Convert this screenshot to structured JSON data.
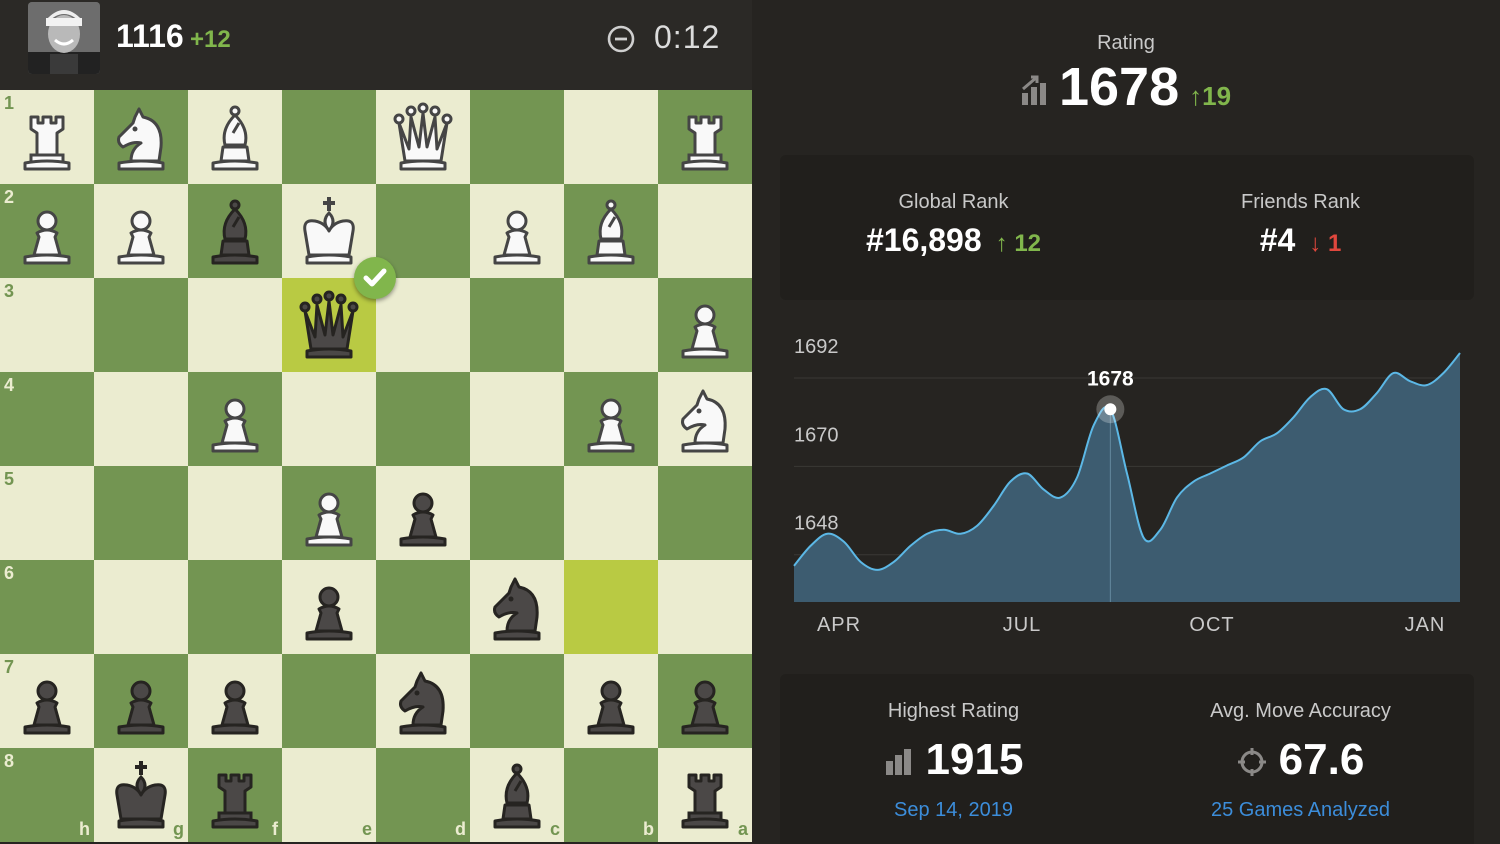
{
  "player": {
    "rating": "1116",
    "rating_delta": "+12",
    "clock": "0:12"
  },
  "board": {
    "rank_labels": [
      "1",
      "2",
      "3",
      "4",
      "5",
      "6",
      "7",
      "8"
    ],
    "file_labels": [
      "h",
      "g",
      "f",
      "e",
      "d",
      "c",
      "b",
      "a"
    ],
    "highlight_squares": [
      "3-3",
      "5-6"
    ],
    "pieces": [
      {
        "r": 0,
        "c": 0,
        "p": "R",
        "w": true
      },
      {
        "r": 0,
        "c": 1,
        "p": "N",
        "w": true
      },
      {
        "r": 0,
        "c": 2,
        "p": "B",
        "w": true
      },
      {
        "r": 0,
        "c": 4,
        "p": "Q",
        "w": true
      },
      {
        "r": 0,
        "c": 7,
        "p": "R",
        "w": true
      },
      {
        "r": 1,
        "c": 0,
        "p": "P",
        "w": true
      },
      {
        "r": 1,
        "c": 1,
        "p": "P",
        "w": true
      },
      {
        "r": 1,
        "c": 2,
        "p": "B",
        "w": false
      },
      {
        "r": 1,
        "c": 3,
        "p": "K",
        "w": true
      },
      {
        "r": 1,
        "c": 5,
        "p": "P",
        "w": true
      },
      {
        "r": 1,
        "c": 6,
        "p": "B",
        "w": true
      },
      {
        "r": 2,
        "c": 3,
        "p": "Q",
        "w": false
      },
      {
        "r": 2,
        "c": 7,
        "p": "P",
        "w": true
      },
      {
        "r": 3,
        "c": 2,
        "p": "P",
        "w": true
      },
      {
        "r": 3,
        "c": 6,
        "p": "P",
        "w": true
      },
      {
        "r": 3,
        "c": 7,
        "p": "N",
        "w": true
      },
      {
        "r": 4,
        "c": 3,
        "p": "P",
        "w": true
      },
      {
        "r": 4,
        "c": 4,
        "p": "P",
        "w": false
      },
      {
        "r": 5,
        "c": 3,
        "p": "P",
        "w": false
      },
      {
        "r": 5,
        "c": 5,
        "p": "N",
        "w": false
      },
      {
        "r": 6,
        "c": 0,
        "p": "P",
        "w": false
      },
      {
        "r": 6,
        "c": 1,
        "p": "P",
        "w": false
      },
      {
        "r": 6,
        "c": 2,
        "p": "P",
        "w": false
      },
      {
        "r": 6,
        "c": 4,
        "p": "N",
        "w": false
      },
      {
        "r": 6,
        "c": 6,
        "p": "P",
        "w": false
      },
      {
        "r": 6,
        "c": 7,
        "p": "P",
        "w": false
      },
      {
        "r": 7,
        "c": 1,
        "p": "K",
        "w": false
      },
      {
        "r": 7,
        "c": 2,
        "p": "R",
        "w": false
      },
      {
        "r": 7,
        "c": 5,
        "p": "B",
        "w": false
      },
      {
        "r": 7,
        "c": 7,
        "p": "R",
        "w": false
      }
    ]
  },
  "rating": {
    "label": "Rating",
    "value": "1678",
    "delta": "19"
  },
  "ranks": {
    "global_label": "Global Rank",
    "global_value": "#16,898",
    "global_delta": "12",
    "friends_label": "Friends Rank",
    "friends_value": "#4",
    "friends_delta": "1"
  },
  "chart_data": {
    "type": "area",
    "x_ticks": [
      "APR",
      "JUL",
      "OCT",
      "JAN"
    ],
    "y_ticks": [
      1692,
      1670,
      1648
    ],
    "ylim": [
      1628,
      1692
    ],
    "tooltip": "1678",
    "series": [
      {
        "values": [
          1637,
          1642,
          1645,
          1643,
          1638,
          1636,
          1638,
          1642,
          1645,
          1646,
          1645,
          1647,
          1652,
          1658,
          1660,
          1656,
          1654,
          1659,
          1672,
          1676,
          1660,
          1644,
          1646,
          1654,
          1658,
          1660,
          1662,
          1664,
          1668,
          1670,
          1674,
          1679,
          1681,
          1676,
          1676,
          1680,
          1685,
          1683,
          1682,
          1685,
          1690
        ],
        "marker_index": 19
      }
    ],
    "colors": {
      "line": "#5cb8e6",
      "fill": "#3d5c70"
    }
  },
  "highest": {
    "label": "Highest Rating",
    "value": "1915",
    "date": "Sep 14, 2019"
  },
  "accuracy": {
    "label": "Avg. Move Accuracy",
    "value": "67.6",
    "sub": "25 Games Analyzed"
  }
}
